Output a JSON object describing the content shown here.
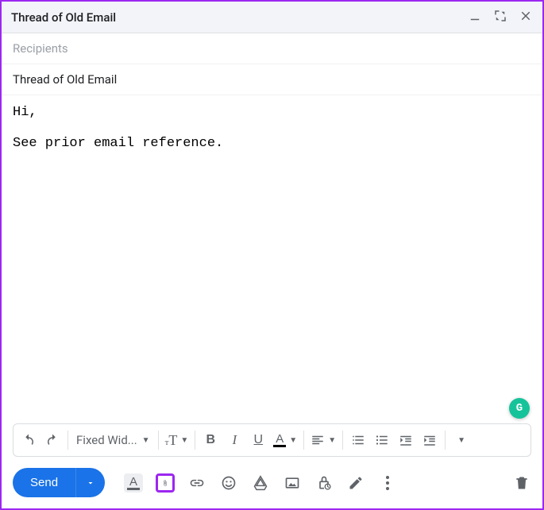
{
  "window": {
    "title": "Thread of Old Email"
  },
  "recipients": {
    "placeholder": "Recipients"
  },
  "subject": {
    "value": "Thread of Old Email"
  },
  "body": {
    "line1": "Hi,",
    "line2": "See prior email reference."
  },
  "format_toolbar": {
    "font_name": "Fixed Wid..."
  },
  "actions": {
    "send_label": "Send"
  },
  "grammarly": {
    "letter": "G"
  }
}
